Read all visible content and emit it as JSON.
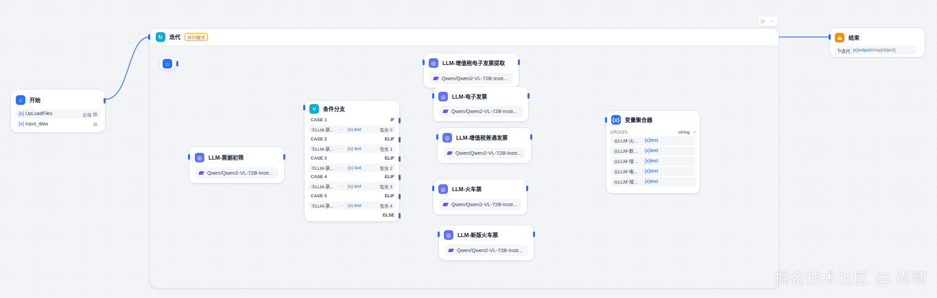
{
  "start_node": {
    "title": "开始",
    "vars": [
      {
        "name": "UpLoadFiles",
        "required": "必填"
      },
      {
        "name": "input_data",
        "required": ""
      }
    ]
  },
  "iteration": {
    "title": "迭代",
    "mode_badge": "并行模式"
  },
  "llm_filter": {
    "title": "LLM-票据初筛",
    "model": "Qwen/Qwen2-VL-72B-Instr..."
  },
  "ifelse": {
    "title": "条件分支",
    "cases": [
      {
        "label": "CASE 1",
        "kw": "IF",
        "var": "LLM-票...",
        "type": "text",
        "op": "包含",
        "val": "0"
      },
      {
        "label": "CASE 2",
        "kw": "ELIF",
        "var": "LLM-票...",
        "type": "text",
        "op": "包含",
        "val": "1"
      },
      {
        "label": "CASE 3",
        "kw": "ELIF",
        "var": "LLM-票...",
        "type": "text",
        "op": "包含",
        "val": "2"
      },
      {
        "label": "CASE 4",
        "kw": "ELIF",
        "var": "LLM-票...",
        "type": "text",
        "op": "包含",
        "val": "3"
      },
      {
        "label": "CASE 5",
        "kw": "ELIF",
        "var": "LLM-票...",
        "type": "text",
        "op": "包含",
        "val": "4"
      }
    ],
    "else_kw": "ELSE"
  },
  "llm_nodes": [
    {
      "title": "LLM-增值税电子发票提取",
      "model": "Qwen/Qwen2-VL-72B-Instr..."
    },
    {
      "title": "LLM-电子发票",
      "model": "Qwen/Qwen2-VL-72B-Instr..."
    },
    {
      "title": "LLM-增值税普通发票",
      "model": "Qwen/Qwen2-VL-72B-Instr..."
    },
    {
      "title": "LLM-火车票",
      "model": "Qwen/Qwen2-VL-72B-Instr..."
    },
    {
      "title": "LLM-新版火车票",
      "model": "Qwen/Qwen2-VL-72B-Instr..."
    }
  ],
  "aggregator": {
    "title": "变量聚合器",
    "group": "GROUP1",
    "group_type": "string",
    "add": "+",
    "items": [
      {
        "node": "LLM-火...",
        "type": "text"
      },
      {
        "node": "LLM-新...",
        "type": "text"
      },
      {
        "node": "LLM-增...",
        "type": "text"
      },
      {
        "node": "LLM-电...",
        "type": "text"
      },
      {
        "node": "LLM-增...",
        "type": "text"
      }
    ]
  },
  "end_node": {
    "title": "结束",
    "src": "迭代",
    "var": "output",
    "type": "Array[object]"
  },
  "watermark": "掘金技术社区 @ 尚啸"
}
